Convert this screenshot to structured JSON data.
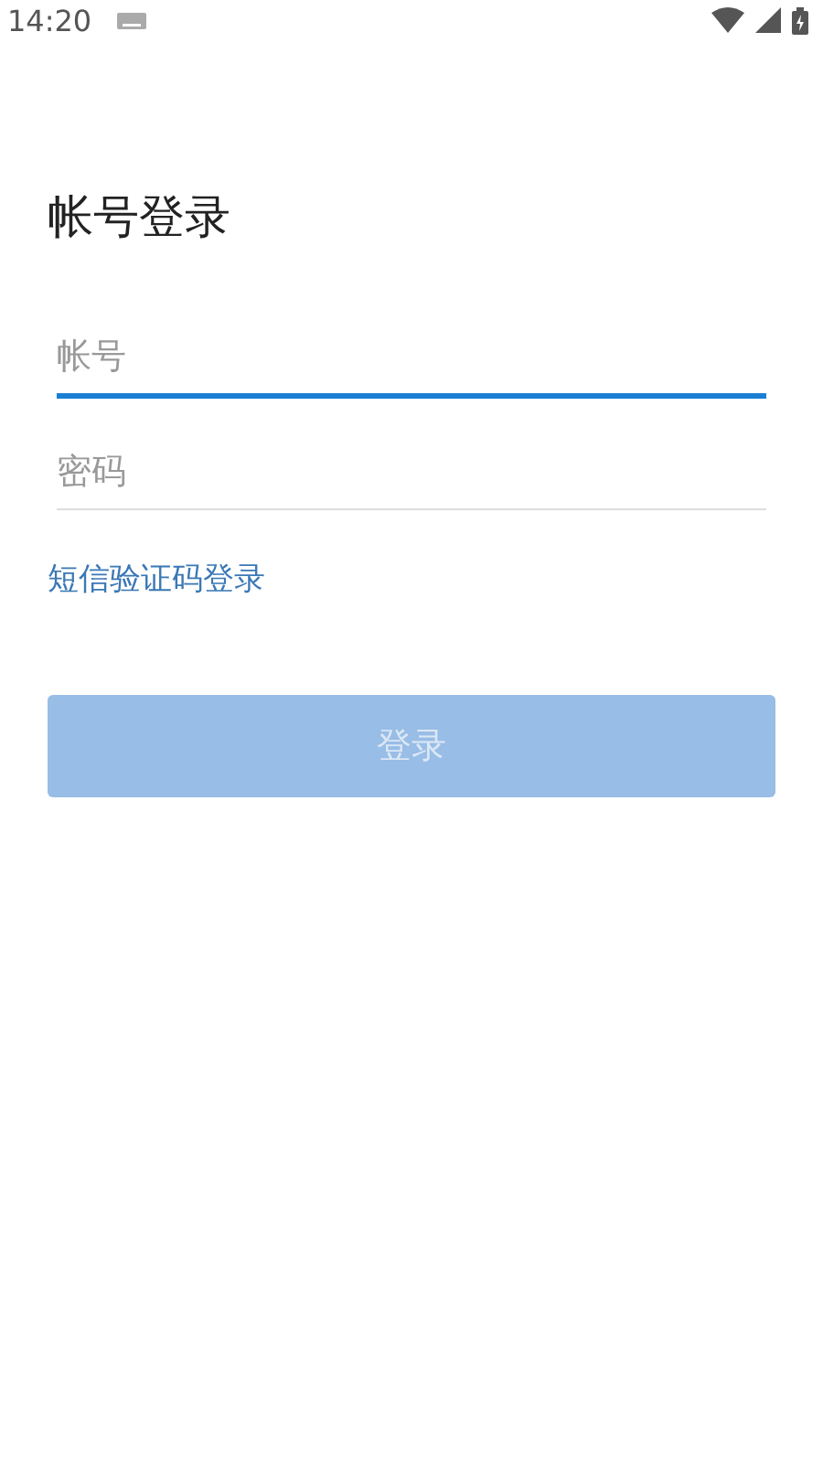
{
  "status_bar": {
    "time": "14:20"
  },
  "title": "帐号登录",
  "fields": [
    {
      "placeholder": "帐号",
      "focused": true
    },
    {
      "placeholder": "密码",
      "focused": false
    }
  ],
  "sms_login_link": "短信验证码登录",
  "login_button": {
    "label": "登录",
    "disabled": true
  }
}
